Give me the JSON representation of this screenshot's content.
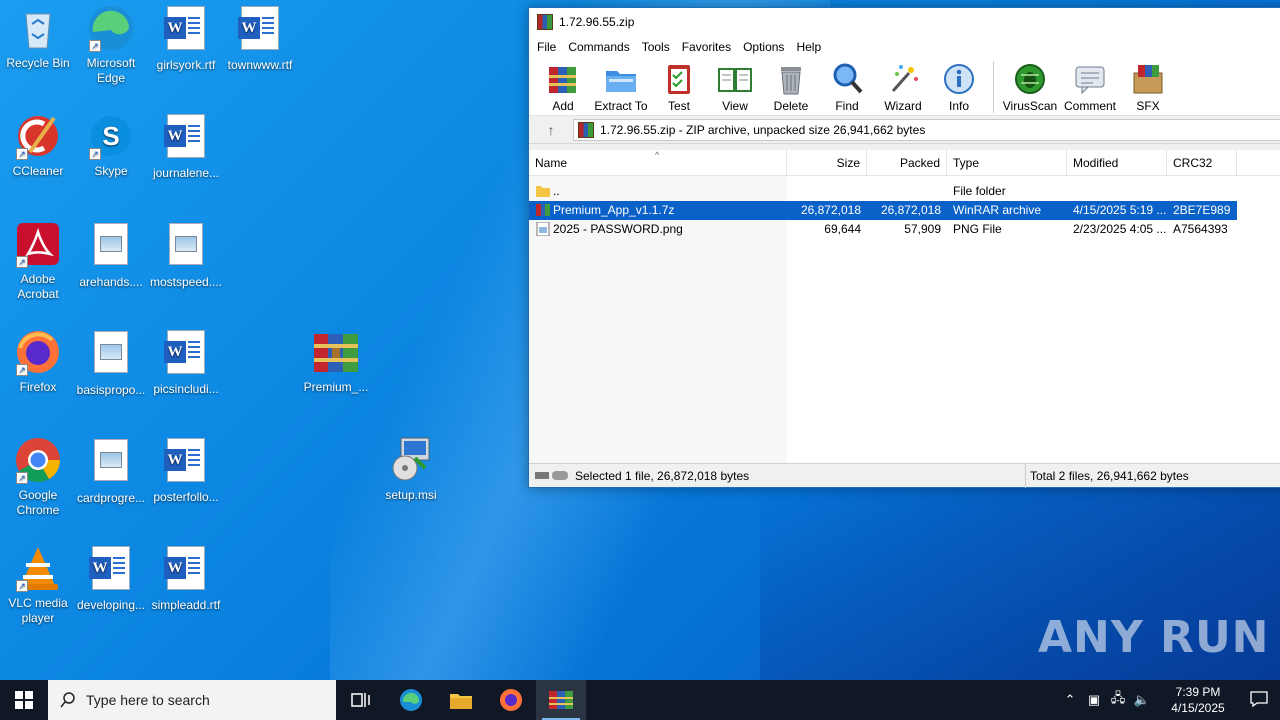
{
  "desktop": {
    "icons": [
      {
        "label": "Recycle Bin",
        "icon": "recycle-bin-icon"
      },
      {
        "label": "Microsoft Edge",
        "icon": "edge-icon"
      },
      {
        "label": "girlsyork.rtf",
        "icon": "word-doc-icon"
      },
      {
        "label": "townwww.rtf",
        "icon": "word-doc-icon"
      },
      {
        "label": "CCleaner",
        "icon": "ccleaner-icon"
      },
      {
        "label": "Skype",
        "icon": "skype-icon"
      },
      {
        "label": "journalene...",
        "icon": "word-doc-icon"
      },
      {
        "label": "Adobe Acrobat",
        "icon": "acrobat-icon"
      },
      {
        "label": "arehands....",
        "icon": "image-file-icon"
      },
      {
        "label": "mostspeed....",
        "icon": "image-file-icon"
      },
      {
        "label": "Firefox",
        "icon": "firefox-icon"
      },
      {
        "label": "basispropo...",
        "icon": "image-file-icon"
      },
      {
        "label": "picsincludi...",
        "icon": "word-doc-icon"
      },
      {
        "label": "Premium_...",
        "icon": "winrar-archive-icon"
      },
      {
        "label": "Google Chrome",
        "icon": "chrome-icon"
      },
      {
        "label": "cardprogre...",
        "icon": "image-file-icon"
      },
      {
        "label": "posterfollo...",
        "icon": "word-doc-icon"
      },
      {
        "label": "setup.msi",
        "icon": "msi-installer-icon"
      },
      {
        "label": "VLC media player",
        "icon": "vlc-icon"
      },
      {
        "label": "developing...",
        "icon": "word-doc-icon"
      },
      {
        "label": "simpleadd.rtf",
        "icon": "word-doc-icon"
      }
    ]
  },
  "window": {
    "title": "1.72.96.55.zip",
    "menu": [
      "File",
      "Commands",
      "Tools",
      "Favorites",
      "Options",
      "Help"
    ],
    "toolbar": [
      "Add",
      "Extract To",
      "Test",
      "View",
      "Delete",
      "Find",
      "Wizard",
      "Info",
      "VirusScan",
      "Comment",
      "SFX"
    ],
    "address": "1.72.96.55.zip - ZIP archive, unpacked size 26,941,662 bytes",
    "columns": [
      "Name",
      "Size",
      "Packed",
      "Type",
      "Modified",
      "CRC32"
    ],
    "rows": [
      {
        "name": "..",
        "size": "",
        "packed": "",
        "type": "File folder",
        "modified": "",
        "crc": "",
        "icon": "folder-icon"
      },
      {
        "name": "Premium_App_v1.1.7z",
        "size": "26,872,018",
        "packed": "26,872,018",
        "type": "WinRAR archive",
        "modified": "4/15/2025 5:19 ...",
        "crc": "2BE7E989",
        "icon": "winrar-archive-icon",
        "selected": true
      },
      {
        "name": "2025 - PASSWORD.png",
        "size": "69,644",
        "packed": "57,909",
        "type": "PNG File",
        "modified": "2/23/2025 4:05 ...",
        "crc": "A7564393",
        "icon": "png-file-icon"
      }
    ],
    "status_left": "Selected 1 file, 26,872,018 bytes",
    "status_right": "Total 2 files, 26,941,662 bytes"
  },
  "watermark": "ANY RUN",
  "taskbar": {
    "search_placeholder": "Type here to search",
    "time": "7:39 PM",
    "date": "4/15/2025"
  },
  "colors": {
    "selection": "#0a62c9",
    "taskbar": "#101826"
  }
}
